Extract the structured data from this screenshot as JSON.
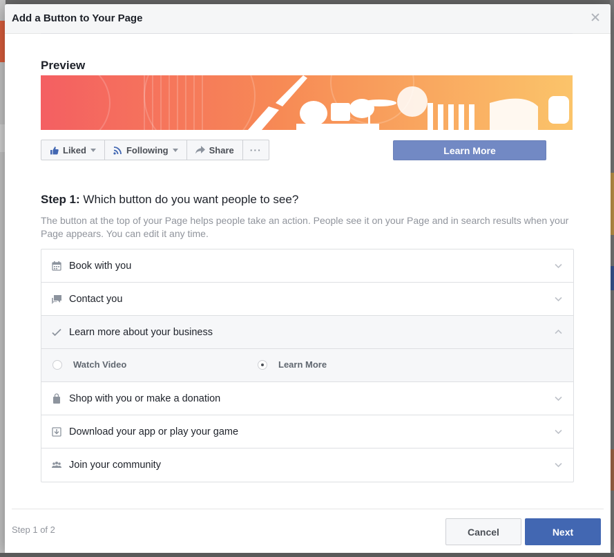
{
  "dialog": {
    "title": "Add a Button to Your Page",
    "close_icon": "close-icon"
  },
  "preview": {
    "heading": "Preview",
    "actions": [
      {
        "label": "Liked",
        "icon": "thumbs-up-icon",
        "dropdown": true
      },
      {
        "label": "Following",
        "icon": "rss-feed-icon",
        "dropdown": true
      },
      {
        "label": "Share",
        "icon": "share-arrow-icon",
        "dropdown": false
      },
      {
        "label": "···",
        "icon": "more-icon",
        "dropdown": false
      }
    ],
    "cta_label": "Learn More",
    "cta_color": "#7289c4"
  },
  "step": {
    "prefix": "Step 1:",
    "question": " Which button do you want people to see?",
    "description": "The button at the top of your Page helps people take an action. People see it on your Page and in search results when your Page appears. You can edit it any time."
  },
  "options": [
    {
      "label": "Book with you",
      "icon": "calendar-icon",
      "expanded": false
    },
    {
      "label": "Contact you",
      "icon": "chat-icon",
      "expanded": false
    },
    {
      "label": "Learn more about your business",
      "icon": "checkmark-icon",
      "expanded": true
    },
    {
      "label": "Shop with you or make a donation",
      "icon": "shopping-bag-icon",
      "expanded": false
    },
    {
      "label": "Download your app or play your game",
      "icon": "download-icon",
      "expanded": false
    },
    {
      "label": "Join your community",
      "icon": "people-icon",
      "expanded": false
    }
  ],
  "sub_options": [
    {
      "label": "Watch Video",
      "selected": false
    },
    {
      "label": "Learn More",
      "selected": true
    }
  ],
  "footer": {
    "step_count": "Step 1 of 2",
    "cancel_label": "Cancel",
    "next_label": "Next",
    "primary_color": "#4267b2"
  }
}
